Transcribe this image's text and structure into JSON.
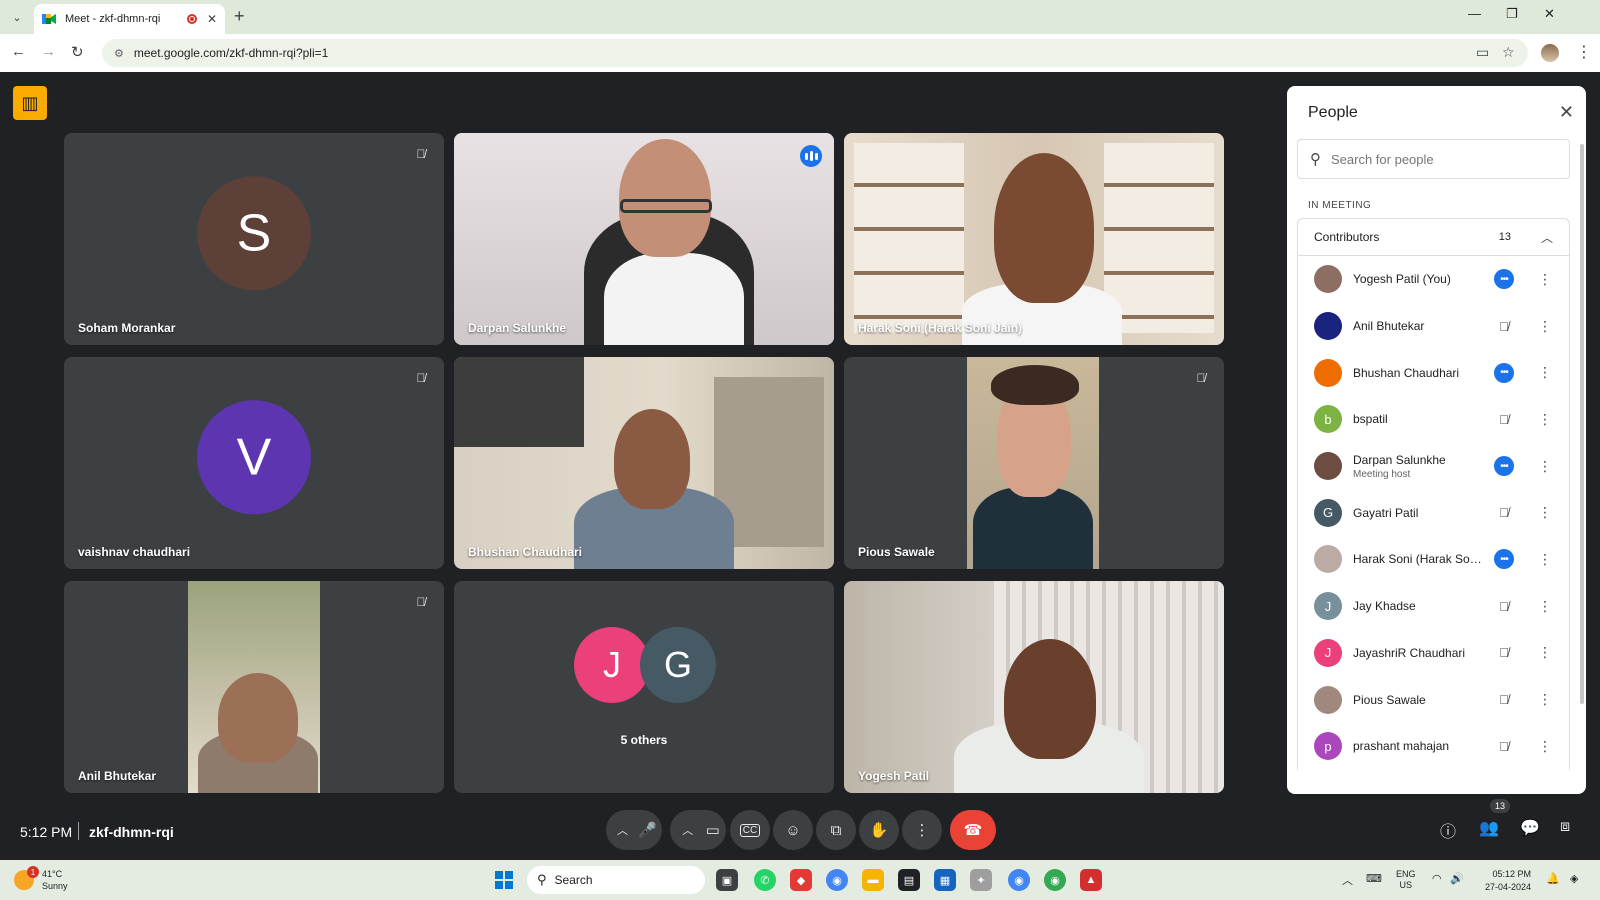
{
  "browser": {
    "tab_title": "Meet - zkf-dhmn-rqi",
    "url": "meet.google.com/zkf-dhmn-rqi?pli=1"
  },
  "tiles": [
    {
      "name": "Soham Morankar",
      "initial": "S",
      "avatar_color": "#5d4037",
      "type": "avatar",
      "muted": true
    },
    {
      "name": "Darpan Salunkhe",
      "type": "video",
      "speaking": true,
      "active": true
    },
    {
      "name": "Harak Soni (Harak Soni Jain)",
      "type": "video"
    },
    {
      "name": "vaishnav chaudhari",
      "initial": "V",
      "avatar_color": "#5e35b1",
      "type": "avatar",
      "muted": true
    },
    {
      "name": "Bhushan Chaudhari",
      "type": "video"
    },
    {
      "name": "Pious Sawale",
      "type": "video",
      "muted": true
    },
    {
      "name": "Anil Bhutekar",
      "type": "video",
      "muted": true
    },
    {
      "name": "5 others",
      "type": "others",
      "initials": [
        "J",
        "G"
      ],
      "colors": [
        "#ec407a",
        "#455a64"
      ]
    },
    {
      "name": "Yogesh Patil",
      "type": "video"
    }
  ],
  "panel": {
    "title": "People",
    "search_placeholder": "Search for people",
    "section": "IN MEETING",
    "group_label": "Contributors",
    "group_count": "13",
    "people": [
      {
        "name": "Yogesh Patil (You)",
        "status": "speaking",
        "avatar": "photo",
        "color": "#8d6e63"
      },
      {
        "name": "Anil Bhutekar",
        "status": "muted",
        "avatar": "photo",
        "color": "#1a237e"
      },
      {
        "name": "Bhushan Chaudhari",
        "status": "speaking",
        "avatar": "photo",
        "color": "#ef6c00"
      },
      {
        "name": "bspatil",
        "status": "muted",
        "avatar": "b",
        "color": "#7cb342"
      },
      {
        "name": "Darpan Salunkhe",
        "sub": "Meeting host",
        "status": "speaking",
        "avatar": "photo",
        "color": "#6d4c41"
      },
      {
        "name": "Gayatri Patil",
        "status": "muted",
        "avatar": "G",
        "color": "#455a64"
      },
      {
        "name": "Harak Soni (Harak Soni ...",
        "status": "speaking",
        "avatar": "photo",
        "color": "#bcaaa4"
      },
      {
        "name": "Jay Khadse",
        "status": "muted",
        "avatar": "J",
        "color": "#78909c"
      },
      {
        "name": "JayashriR Chaudhari",
        "status": "muted",
        "avatar": "J",
        "color": "#ec407a"
      },
      {
        "name": "Pious Sawale",
        "status": "muted",
        "avatar": "photo",
        "color": "#a1887f"
      },
      {
        "name": "prashant mahajan",
        "status": "muted",
        "avatar": "p",
        "color": "#ab47bc"
      }
    ]
  },
  "bottom": {
    "time": "5:12 PM",
    "meeting_code": "zkf-dhmn-rqi",
    "people_badge": "13",
    "end_call_color": "#ea4335"
  },
  "taskbar": {
    "temp": "41°C",
    "weather": "Sunny",
    "weather_badge": "1",
    "search": "Search",
    "lang1": "ENG",
    "lang2": "US",
    "clock_time": "05:12 PM",
    "clock_date": "27-04-2024"
  }
}
